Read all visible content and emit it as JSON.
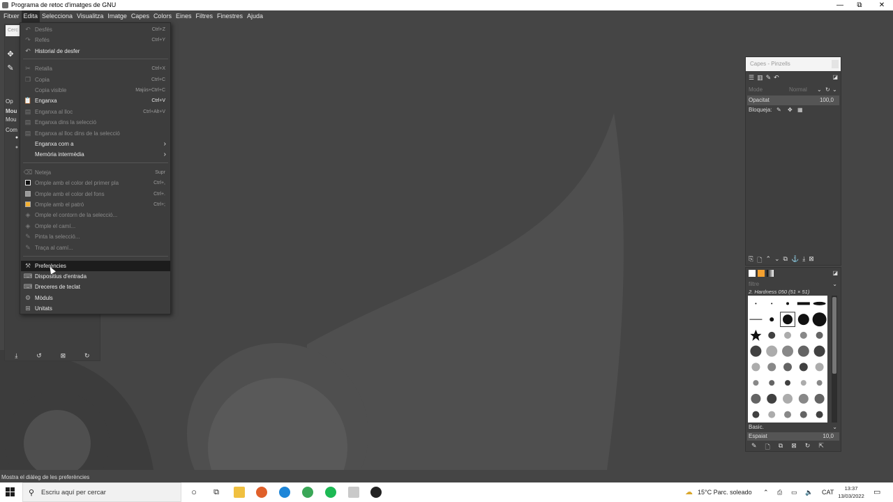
{
  "window": {
    "title": "Programa de retoc d'imatges de GNU",
    "controls": {
      "minimize": "—",
      "maximize": "⧉",
      "close": "✕"
    }
  },
  "menubar": [
    "Fitxer",
    "Edita",
    "Selecciona",
    "Visualitza",
    "Imatge",
    "Capes",
    "Colors",
    "Eines",
    "Filtres",
    "Finestres",
    "Ajuda"
  ],
  "menubar_active": "Edita",
  "edit_menu": {
    "items": [
      {
        "label": "Desfés",
        "shortcut": "Ctrl+Z",
        "icon": "undo-icon",
        "disabled": true
      },
      {
        "label": "Refés",
        "shortcut": "Ctrl+Y",
        "icon": "redo-icon",
        "disabled": true
      },
      {
        "label": "Historial de desfer",
        "shortcut": "",
        "icon": "undo-history-icon",
        "disabled": false
      },
      {
        "label": "Retalla",
        "shortcut": "Ctrl+X",
        "icon": "cut-icon",
        "disabled": true
      },
      {
        "label": "Copia",
        "shortcut": "Ctrl+C",
        "icon": "copy-icon",
        "disabled": true
      },
      {
        "label": "Copia visible",
        "shortcut": "Majús+Ctrl+C",
        "icon": "",
        "disabled": true
      },
      {
        "label": "Enganxa",
        "shortcut": "Ctrl+V",
        "icon": "paste-icon",
        "disabled": false
      },
      {
        "label": "Enganxa al lloc",
        "shortcut": "Ctrl+Alt+V",
        "icon": "paste-in-place-icon",
        "disabled": true
      },
      {
        "label": "Enganxa dins la selecció",
        "shortcut": "",
        "icon": "paste-into-icon",
        "disabled": true
      },
      {
        "label": "Enganxa al lloc dins de la selecció",
        "shortcut": "",
        "icon": "paste-into-in-place-icon",
        "disabled": true
      },
      {
        "label": "Enganxa com a",
        "shortcut": "",
        "icon": "",
        "disabled": false,
        "submenu": true
      },
      {
        "label": "Memòria intermèdia",
        "shortcut": "",
        "icon": "",
        "disabled": false,
        "submenu": true
      },
      {
        "label": "Neteja",
        "shortcut": "Supr",
        "icon": "clear-icon",
        "disabled": true
      },
      {
        "label": "Omple amb el color del primer pla",
        "shortcut": "Ctrl+,",
        "icon": "fill-fg-icon",
        "disabled": true
      },
      {
        "label": "Omple amb el color del fons",
        "shortcut": "Ctrl+.",
        "icon": "fill-bg-icon",
        "disabled": true
      },
      {
        "label": "Omple amb el patró",
        "shortcut": "Ctrl+;",
        "icon": "fill-pattern-icon",
        "disabled": true
      },
      {
        "label": "Omple el contorn de la selecció...",
        "shortcut": "",
        "icon": "fill-selection-outline-icon",
        "disabled": true
      },
      {
        "label": "Omple el camí...",
        "shortcut": "",
        "icon": "fill-path-icon",
        "disabled": true
      },
      {
        "label": "Pinta la selecció...",
        "shortcut": "",
        "icon": "stroke-selection-icon",
        "disabled": true
      },
      {
        "label": "Traça al camí...",
        "shortcut": "",
        "icon": "stroke-path-icon",
        "disabled": true
      },
      {
        "label": "Preferències",
        "shortcut": "",
        "icon": "preferences-icon",
        "disabled": false,
        "selected": true
      },
      {
        "label": "Dispositius d'entrada",
        "shortcut": "",
        "icon": "input-devices-icon",
        "disabled": false
      },
      {
        "label": "Dreceres de teclat",
        "shortcut": "",
        "icon": "keyboard-shortcuts-icon",
        "disabled": false
      },
      {
        "label": "Mòduls",
        "shortcut": "",
        "icon": "modules-icon",
        "disabled": false
      },
      {
        "label": "Unitats",
        "shortcut": "",
        "icon": "units-icon",
        "disabled": false
      }
    ]
  },
  "left_panel": {
    "search_placeholder": "Cerc",
    "labels": [
      "Op",
      "Mou",
      "Mou",
      "Com"
    ]
  },
  "layers_dock": {
    "tab_label": "Capes - Pinzells",
    "mode_label": "Mode",
    "mode_value": "Normal",
    "opacity_label": "Opacitat",
    "opacity_value": "100,0",
    "lock_label": "Bloqueja:"
  },
  "brushes_dock": {
    "filter_placeholder": "filtre",
    "selected_brush": "2. Hardness 050 (51 × 51)",
    "preset": "Basic.",
    "spacing_label": "Espaiat",
    "spacing_value": "10,0"
  },
  "statusbar": {
    "text": "Mostra el diàleg de les preferències"
  },
  "taskbar": {
    "search_placeholder": "Escriu aquí per cercar",
    "weather": "15°C  Parc. soleado",
    "language": "CAT",
    "time": "13:37",
    "date": "13/03/2022"
  }
}
